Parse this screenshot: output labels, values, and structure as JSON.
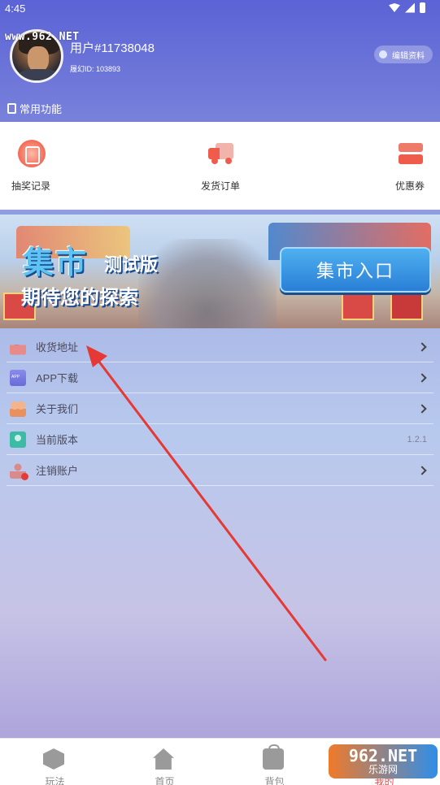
{
  "status_bar": {
    "time": "4:45"
  },
  "watermarks": {
    "top": "www.962.NET",
    "bottom_brand": "962.NET",
    "bottom_sub": "乐游网"
  },
  "profile": {
    "username": "用户#11738048",
    "user_id": "履幻ID: 103893",
    "edit_button": "编辑资料"
  },
  "section": {
    "title": "常用功能"
  },
  "functions": [
    {
      "label": "抽奖记录",
      "icon": "lottery-icon"
    },
    {
      "label": "发货订单",
      "icon": "truck-icon"
    },
    {
      "label": "优惠券",
      "icon": "coupon-icon"
    }
  ],
  "banner": {
    "title": "集市",
    "tag": "测试版",
    "subtitle": "期待您的探索",
    "button": "集市入口"
  },
  "menu": [
    {
      "label": "收货地址",
      "icon": "address-icon",
      "value": "",
      "has_chevron": true
    },
    {
      "label": "APP下载",
      "icon": "app-download-icon",
      "value": "",
      "has_chevron": true
    },
    {
      "label": "关于我们",
      "icon": "about-icon",
      "value": "",
      "has_chevron": true
    },
    {
      "label": "当前版本",
      "icon": "version-icon",
      "value": "1.2.1",
      "has_chevron": false
    },
    {
      "label": "注销账户",
      "icon": "delete-account-icon",
      "value": "",
      "has_chevron": true
    }
  ],
  "bottom_nav": [
    {
      "label": "玩法",
      "icon": "play-icon",
      "active": false
    },
    {
      "label": "首页",
      "icon": "home-icon",
      "active": false
    },
    {
      "label": "背包",
      "icon": "bag-icon",
      "active": false
    },
    {
      "label": "我的",
      "icon": "mine-icon",
      "active": true
    }
  ],
  "colors": {
    "accent": "#e24c4c",
    "header_blue": "#5b63d6",
    "annotation_arrow": "#e53935"
  }
}
